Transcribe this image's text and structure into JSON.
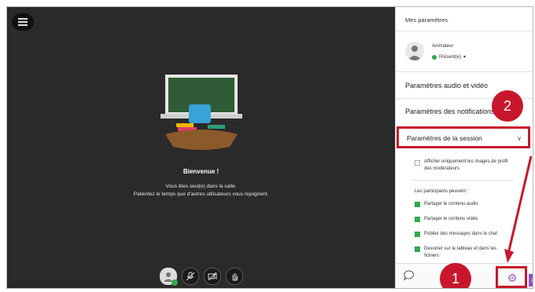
{
  "stage": {
    "welcome_title": "Bienvenue !",
    "welcome_line1": "Vous êtes seul(e) dans la salle.",
    "welcome_line2": "Patientez le temps que d'autres utilisateurs vous rejoignent."
  },
  "panel": {
    "header": "Mes paramètres",
    "user_role": "Animateur",
    "user_status": "Présent(e)",
    "sections": {
      "audio_video": "Paramètres audio et vidéo",
      "notifications": "Paramètres des notifications",
      "session": "Paramètres de la session"
    },
    "option_only_moderators": "Afficher uniquement les images de profil des modérateurs",
    "participants_can_label": "Les participants peuvent :",
    "permissions": [
      "Partager le contenu audio",
      "Partager le contenu vidéo",
      "Publier des messages dans le chat",
      "Dessiner sur le tableau et dans les fichiers"
    ]
  },
  "callouts": {
    "one": "1",
    "two": "2"
  },
  "colors": {
    "accent_red": "#c8172c",
    "green": "#2eaa4f",
    "stage_bg": "#2a2a2a"
  },
  "icons": [
    "menu-icon",
    "avatar-icon",
    "mic-off-icon",
    "camera-off-icon",
    "hand-raise-icon",
    "chat-icon",
    "settings-gear-icon",
    "chevron-down-icon"
  ]
}
